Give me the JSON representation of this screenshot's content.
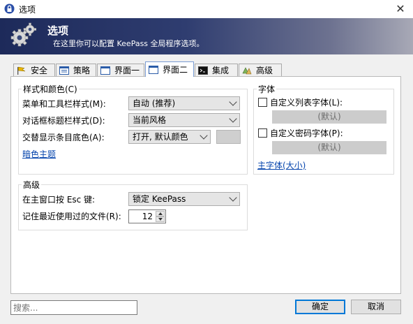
{
  "window": {
    "title": "选项",
    "close": "✕"
  },
  "banner": {
    "title": "选项",
    "subtitle": "在这里你可以配置 KeePass 全局程序选项。"
  },
  "tabs": [
    {
      "label": "安全",
      "icon": "security-flag-icon"
    },
    {
      "label": "策略",
      "icon": "policy-list-icon"
    },
    {
      "label": "界面一",
      "icon": "interface-window-icon"
    },
    {
      "label": "界面二",
      "icon": "interface-window-icon"
    },
    {
      "label": "集成",
      "icon": "console-icon"
    },
    {
      "label": "高级",
      "icon": "advanced-icon"
    }
  ],
  "style_group": {
    "title": "样式和颜色(C)",
    "menu_style_label": "菜单和工具栏样式(M):",
    "menu_style_value": "自动 (推荐)",
    "dialog_style_label": "对话框标题栏样式(D):",
    "dialog_style_value": "当前风格",
    "alt_color_label": "交替显示条目底色(A):",
    "alt_color_value": "打开, 默认颜色",
    "dark_theme_link": "暗色主题"
  },
  "font_group": {
    "title": "字体",
    "custom_list_font_label": "自定义列表字体(L):",
    "custom_list_font_value": "(默认)",
    "custom_password_font_label": "自定义密码字体(P):",
    "custom_password_font_value": "(默认)",
    "main_font_link": "主字体(大小)"
  },
  "advanced_group": {
    "title": "高级",
    "esc_label": "在主窗口按 Esc 键:",
    "esc_value": "锁定 KeePass",
    "mru_label": "记住最近使用过的文件(R):",
    "mru_value": "12"
  },
  "footer": {
    "search_placeholder": "搜索...",
    "ok_label": "确定",
    "cancel_label": "取消"
  },
  "colors": {
    "accent": "#0078d7",
    "link": "#0645ad"
  }
}
